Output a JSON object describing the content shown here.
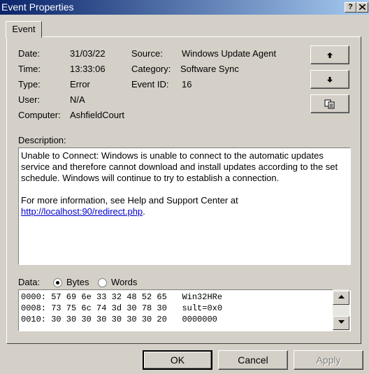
{
  "window": {
    "title": "Event Properties",
    "help_label": "?",
    "close_label": "X"
  },
  "tabs": [
    {
      "label": "Event"
    }
  ],
  "details": {
    "date_label": "Date:",
    "date_value": "31/03/22",
    "time_label": "Time:",
    "time_value": "13:33:06",
    "type_label": "Type:",
    "type_value": "Error",
    "user_label": "User:",
    "user_value": "N/A",
    "computer_label": "Computer:",
    "computer_value": "AshfieldCourt",
    "source_label": "Source:",
    "source_value": "Windows Update Agent",
    "category_label": "Category:",
    "category_value": "Software Sync",
    "eventid_label": "Event ID:",
    "eventid_value": "16"
  },
  "side_buttons": {
    "up_icon": "arrow-up-icon",
    "down_icon": "arrow-down-icon",
    "copy_icon": "copy-icon"
  },
  "description": {
    "label": "Description:",
    "line1": "Unable to Connect: Windows is unable to connect to the automatic updates",
    "line2": "service and therefore cannot download and install updates according to the set",
    "line3": "schedule. Windows will continue to try to establish a connection.",
    "line4": "For more information, see Help and Support Center at",
    "link": "http://localhost:90/redirect.php",
    "link_suffix": "."
  },
  "data_section": {
    "label": "Data:",
    "bytes_label": "Bytes",
    "words_label": "Words",
    "selected": "Bytes",
    "rows": [
      "0000: 57 69 6e 33 32 48 52 65   Win32HRe",
      "0008: 73 75 6c 74 3d 30 78 30   sult=0x0",
      "0010: 30 30 30 30 30 30 30 20   0000000"
    ]
  },
  "footer": {
    "ok_label": "OK",
    "cancel_label": "Cancel",
    "apply_label": "Apply"
  }
}
